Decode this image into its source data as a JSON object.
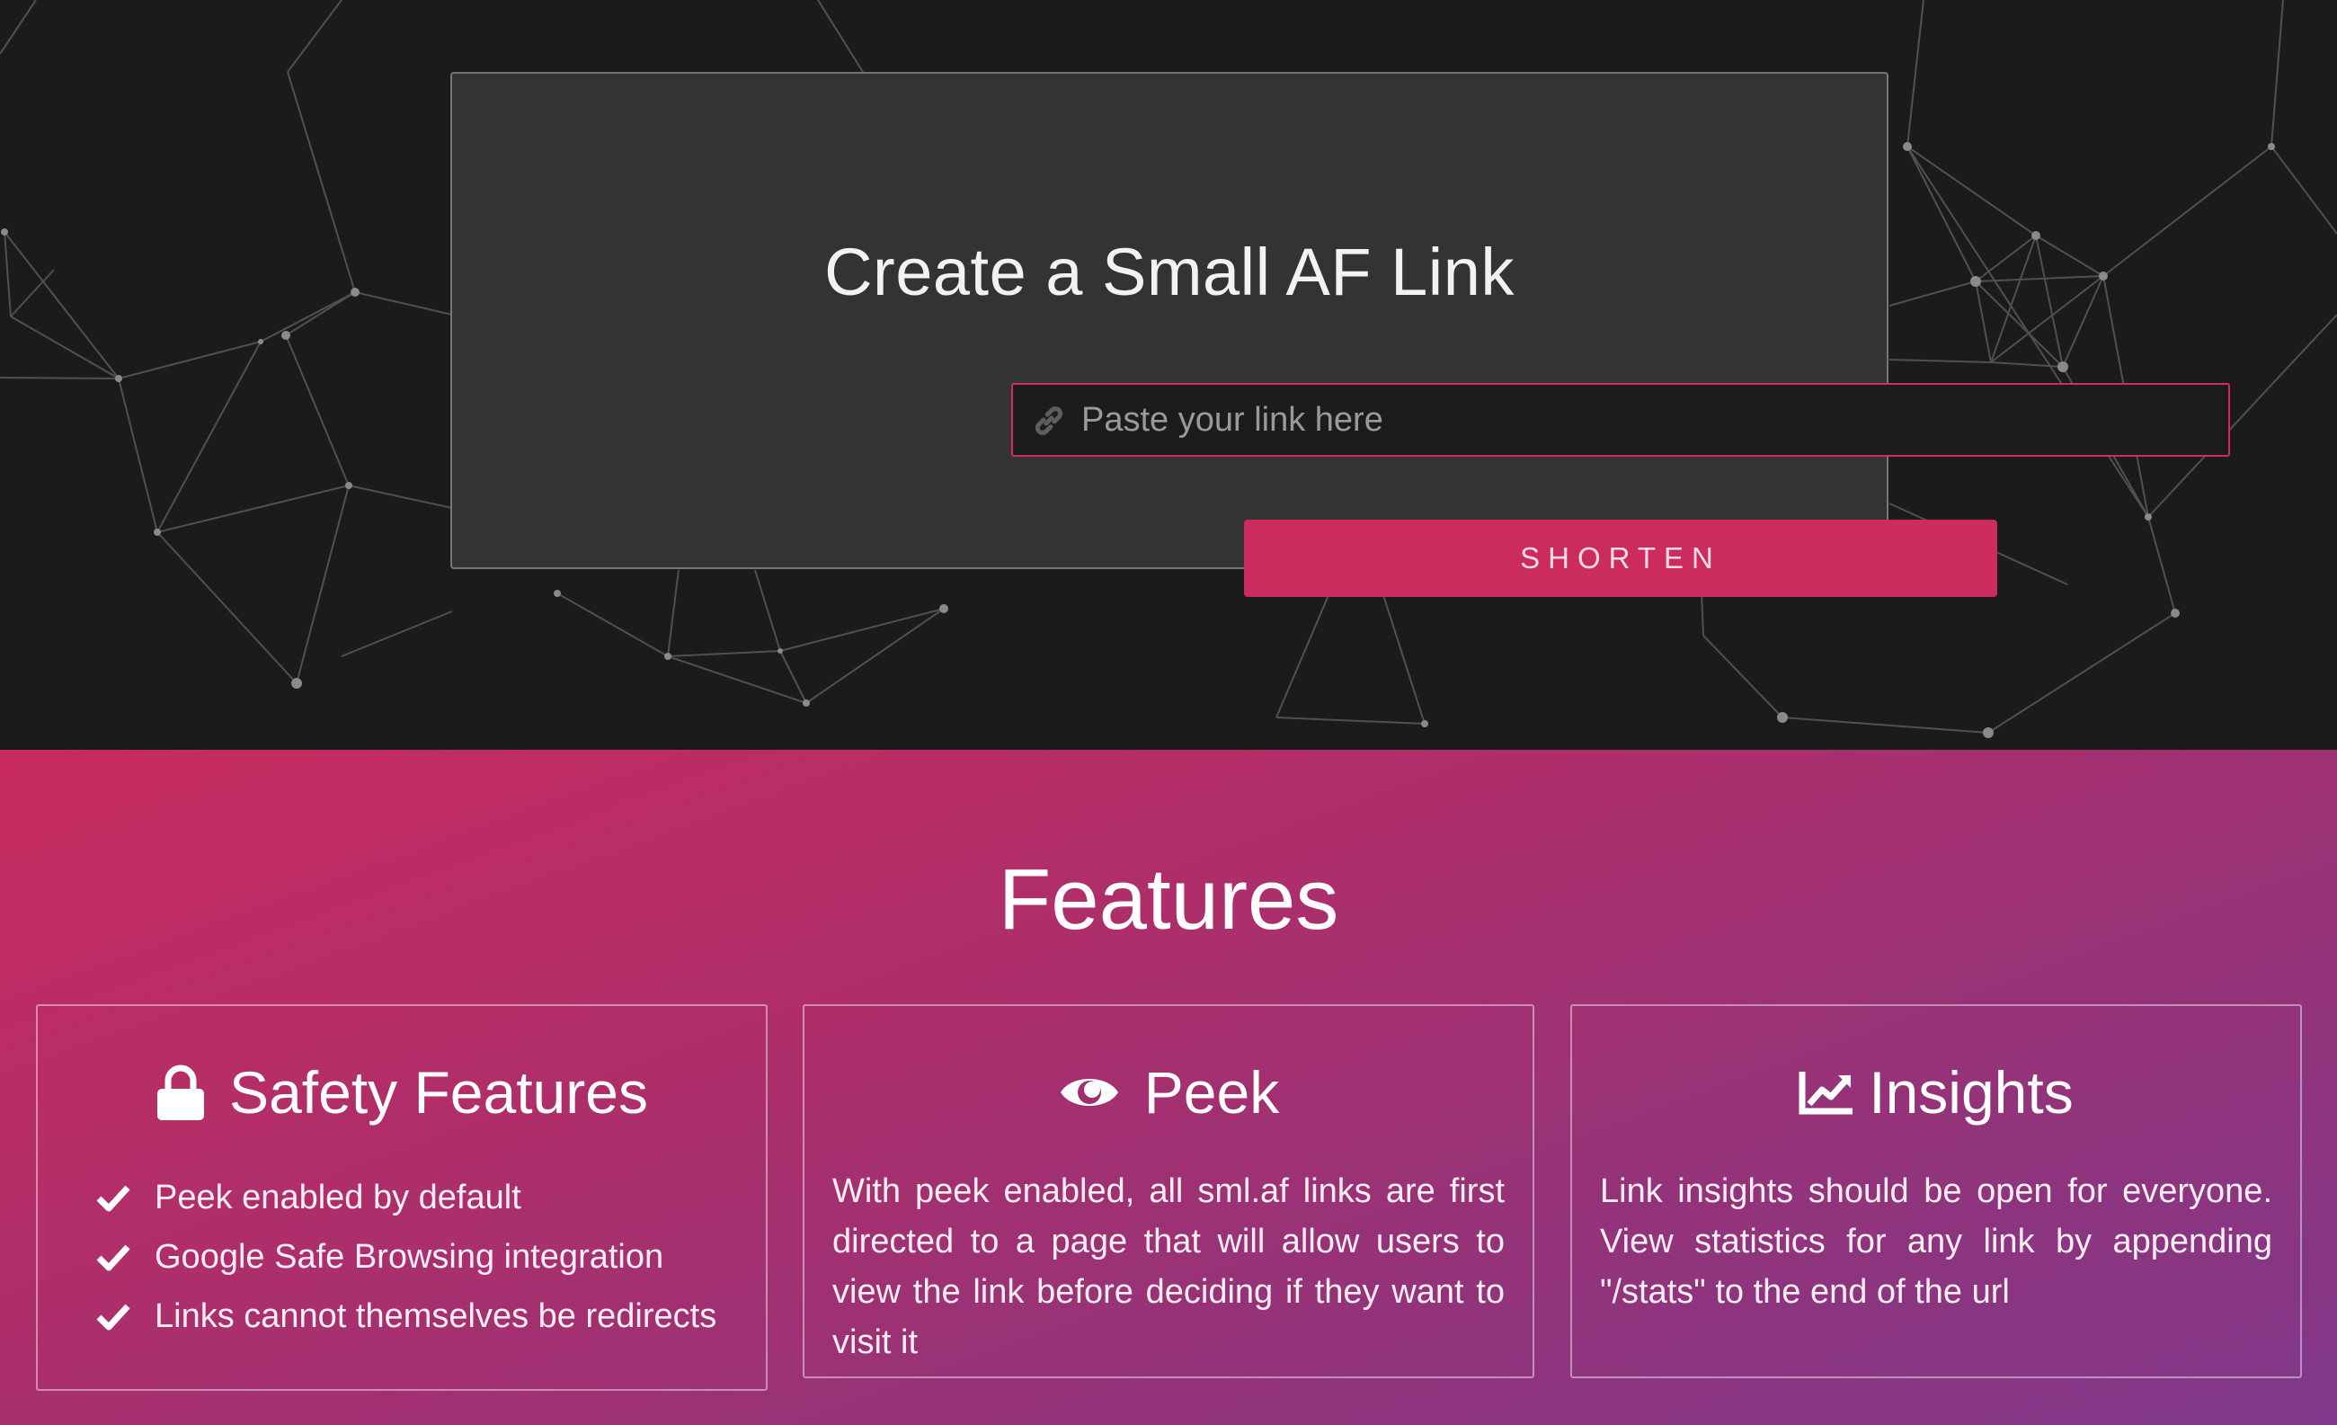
{
  "hero": {
    "title": "Create a Small AF Link",
    "input_placeholder": "Paste your link here",
    "input_value": "",
    "input_icon": "link-icon",
    "shorten_label": "SHORTEN"
  },
  "features": {
    "title": "Features",
    "cards": [
      {
        "icon": "lock-icon",
        "title": "Safety Features",
        "items": [
          "Peek enabled by default",
          "Google Safe Browsing integration",
          "Links cannot themselves be redirects"
        ]
      },
      {
        "icon": "eye-icon",
        "title": "Peek",
        "description": "With peek enabled, all sml.af links are first directed to a page that will allow users to view the link before deciding if they want to visit it"
      },
      {
        "icon": "chart-line-icon",
        "title": "Insights",
        "description": "Link insights should be open for everyone. View statistics for any link by appending \"/stats\" to the end of the url"
      }
    ]
  },
  "colors": {
    "accent": "#cc2b5e",
    "hero_background": "#1b1b1c",
    "card_background": "#333334",
    "gradient_start": "#c82b5f",
    "gradient_end": "#80388a"
  }
}
